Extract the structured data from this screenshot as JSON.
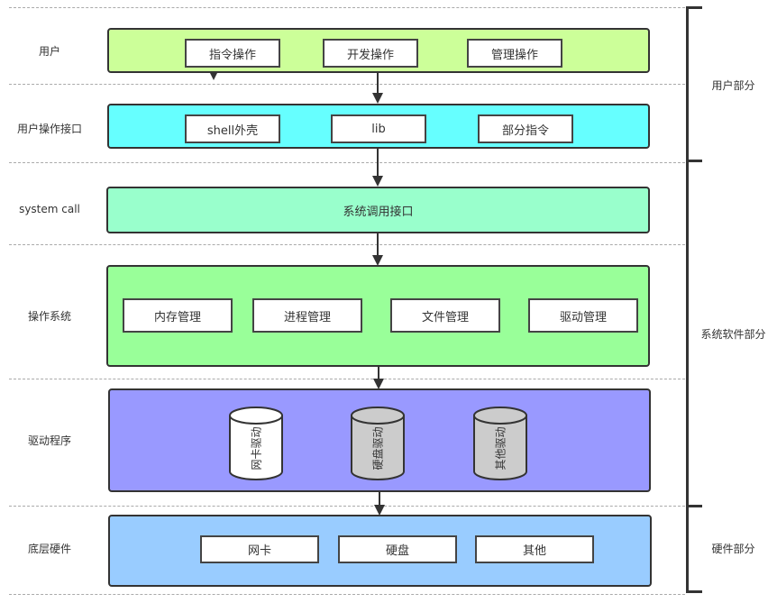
{
  "layers": [
    {
      "label": "用户",
      "color": "#ccff99",
      "items": [
        "指令操作",
        "开发操作",
        "管理操作"
      ]
    },
    {
      "label": "用户操作接口",
      "color": "#66ffff",
      "items": [
        "shell外壳",
        "lib",
        "部分指令"
      ]
    },
    {
      "label": "system call",
      "color": "#99ffcc",
      "title": "系统调用接口"
    },
    {
      "label": "操作系统",
      "color": "#99ff99",
      "items": [
        "内存管理",
        "进程管理",
        "文件管理",
        "驱动管理"
      ]
    },
    {
      "label": "驱动程序",
      "color": "#9999ff",
      "drivers": [
        {
          "label": "网卡驱动",
          "fill": "#ffffff"
        },
        {
          "label": "硬盘驱动",
          "fill": "#cccccc"
        },
        {
          "label": "其他驱动",
          "fill": "#cccccc"
        }
      ]
    },
    {
      "label": "底层硬件",
      "color": "#99ccff",
      "items": [
        "网卡",
        "硬盘",
        "其他"
      ]
    }
  ],
  "sections": [
    "用户部分",
    "系统软件部分",
    "硬件部分"
  ]
}
